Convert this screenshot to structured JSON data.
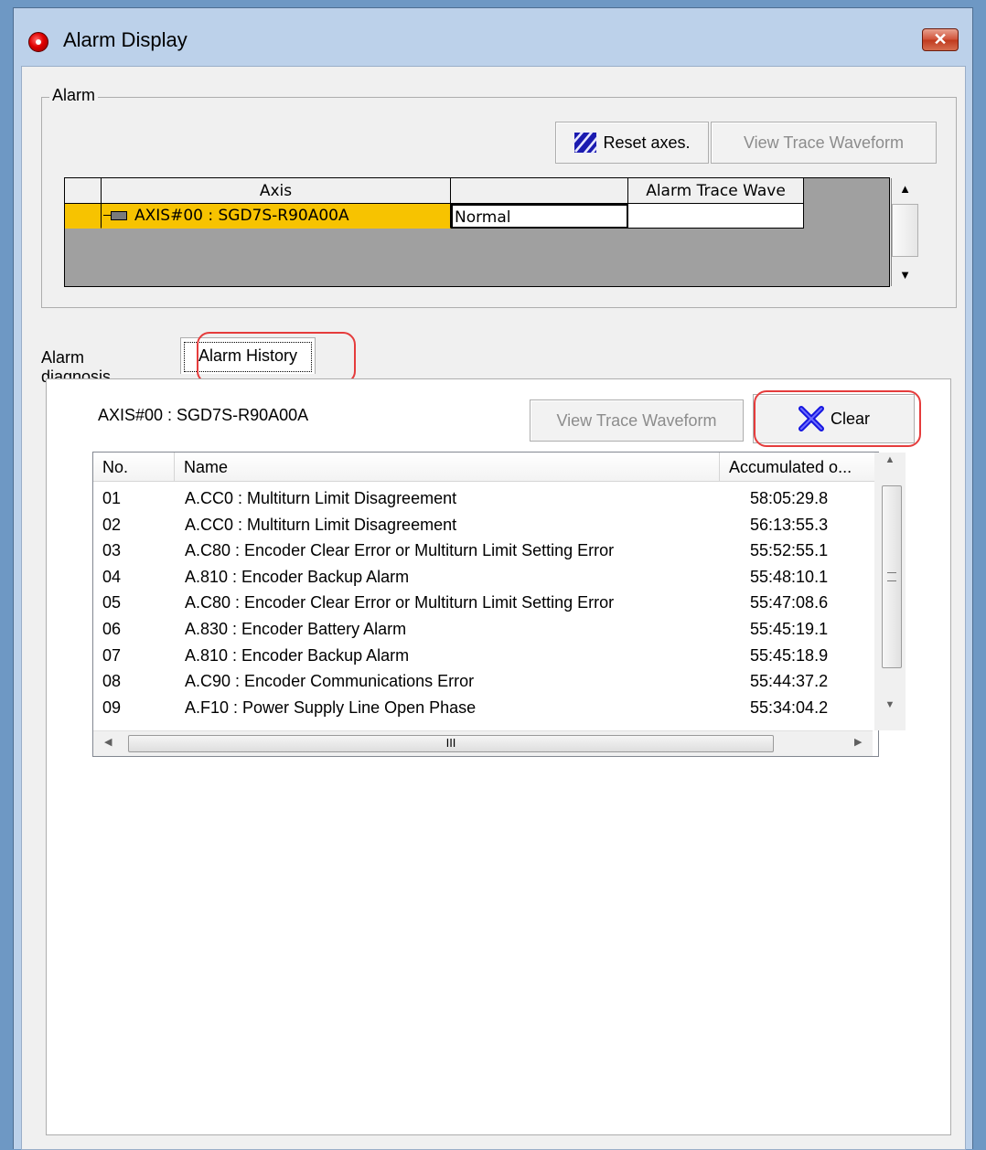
{
  "window": {
    "title": "Alarm Display",
    "close_label": "✕"
  },
  "alarm_group": {
    "label": "Alarm",
    "reset_axes_label": "Reset axes.",
    "view_trace_label": "View Trace Waveform",
    "grid": {
      "headers": [
        "",
        "Axis",
        "",
        "Alarm Trace Wave"
      ],
      "row": {
        "axis": "AXIS#00 : SGD7S-R90A00A",
        "status": "Normal",
        "trace": ""
      }
    }
  },
  "tabs": [
    {
      "label": "Alarm diagnosis",
      "active": false
    },
    {
      "label": "Alarm History",
      "active": true
    }
  ],
  "history_panel": {
    "axis_label": "AXIS#00 : SGD7S-R90A00A",
    "view_trace_label": "View Trace Waveform",
    "clear_label": "Clear",
    "columns": [
      "No.",
      "Name",
      "Accumulated o..."
    ],
    "rows": [
      {
        "no": "01",
        "name": "A.CC0 : Multiturn Limit Disagreement",
        "time": "58:05:29.8"
      },
      {
        "no": "02",
        "name": "A.CC0 : Multiturn Limit Disagreement",
        "time": "56:13:55.3"
      },
      {
        "no": "03",
        "name": "A.C80 : Encoder Clear Error or Multiturn Limit Setting Error",
        "time": "55:52:55.1"
      },
      {
        "no": "04",
        "name": "A.810 : Encoder Backup Alarm",
        "time": "55:48:10.1"
      },
      {
        "no": "05",
        "name": "A.C80 : Encoder Clear Error or Multiturn Limit Setting Error",
        "time": "55:47:08.6"
      },
      {
        "no": "06",
        "name": "A.830 : Encoder Battery Alarm",
        "time": "55:45:19.1"
      },
      {
        "no": "07",
        "name": "A.810 : Encoder Backup Alarm",
        "time": "55:45:18.9"
      },
      {
        "no": "08",
        "name": "A.C90 : Encoder Communications Error",
        "time": "55:44:37.2"
      },
      {
        "no": "09",
        "name": "A.F10 : Power Supply Line Open Phase",
        "time": "55:34:04.2"
      }
    ]
  },
  "colors": {
    "selected_row": "#f7c300",
    "callout": "#e53c3c",
    "clear_icon": "#1515e0"
  }
}
